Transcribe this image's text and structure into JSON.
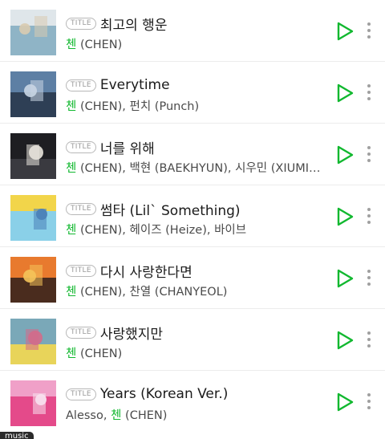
{
  "accent_color": "#11b82f",
  "badge_label": "TITLE",
  "songs": [
    {
      "title": "최고의 행운",
      "artists": [
        {
          "text": "첸",
          "highlight": true
        },
        {
          "text": " (CHEN)",
          "highlight": false
        }
      ],
      "art": [
        "#dfe6ea",
        "#8fb4c6",
        "#d9cbb0"
      ]
    },
    {
      "title": "Everytime",
      "artists": [
        {
          "text": "첸",
          "highlight": true
        },
        {
          "text": " (CHEN), 펀치 (Punch)",
          "highlight": false
        }
      ],
      "art": [
        "#5d7fa4",
        "#2e3f55",
        "#c9d6e4"
      ]
    },
    {
      "title": "너를 위해",
      "artists": [
        {
          "text": "첸",
          "highlight": true
        },
        {
          "text": " (CHEN), 백현 (BAEKHYUN), 시우민 (XIUMIN)",
          "highlight": false
        }
      ],
      "art": [
        "#1e1e22",
        "#3a3a40",
        "#e8e4dc"
      ]
    },
    {
      "title": "썸타 (Lil` Something)",
      "artists": [
        {
          "text": "첸",
          "highlight": true
        },
        {
          "text": " (CHEN), 헤이즈 (Heize), 바이브",
          "highlight": false
        }
      ],
      "art": [
        "#f2d54a",
        "#8ad0e8",
        "#4a7fb8"
      ]
    },
    {
      "title": "다시 사랑한다면",
      "artists": [
        {
          "text": "첸",
          "highlight": true
        },
        {
          "text": " (CHEN), 찬열 (CHANYEOL)",
          "highlight": false
        }
      ],
      "art": [
        "#e87a2e",
        "#4a2c1e",
        "#f4c35a"
      ]
    },
    {
      "title": "사랑했지만",
      "artists": [
        {
          "text": "첸",
          "highlight": true
        },
        {
          "text": " (CHEN)",
          "highlight": false
        }
      ],
      "art": [
        "#7aa8b8",
        "#e8d45a",
        "#d46a8a"
      ]
    },
    {
      "title": "Years (Korean Ver.)",
      "artists": [
        {
          "text": "Alesso, ",
          "highlight": false
        },
        {
          "text": "첸",
          "highlight": true
        },
        {
          "text": " (CHEN)",
          "highlight": false
        }
      ],
      "art": [
        "#f0a0c8",
        "#e44a8a",
        "#f8e2ef"
      ]
    }
  ],
  "music_tag": "music"
}
